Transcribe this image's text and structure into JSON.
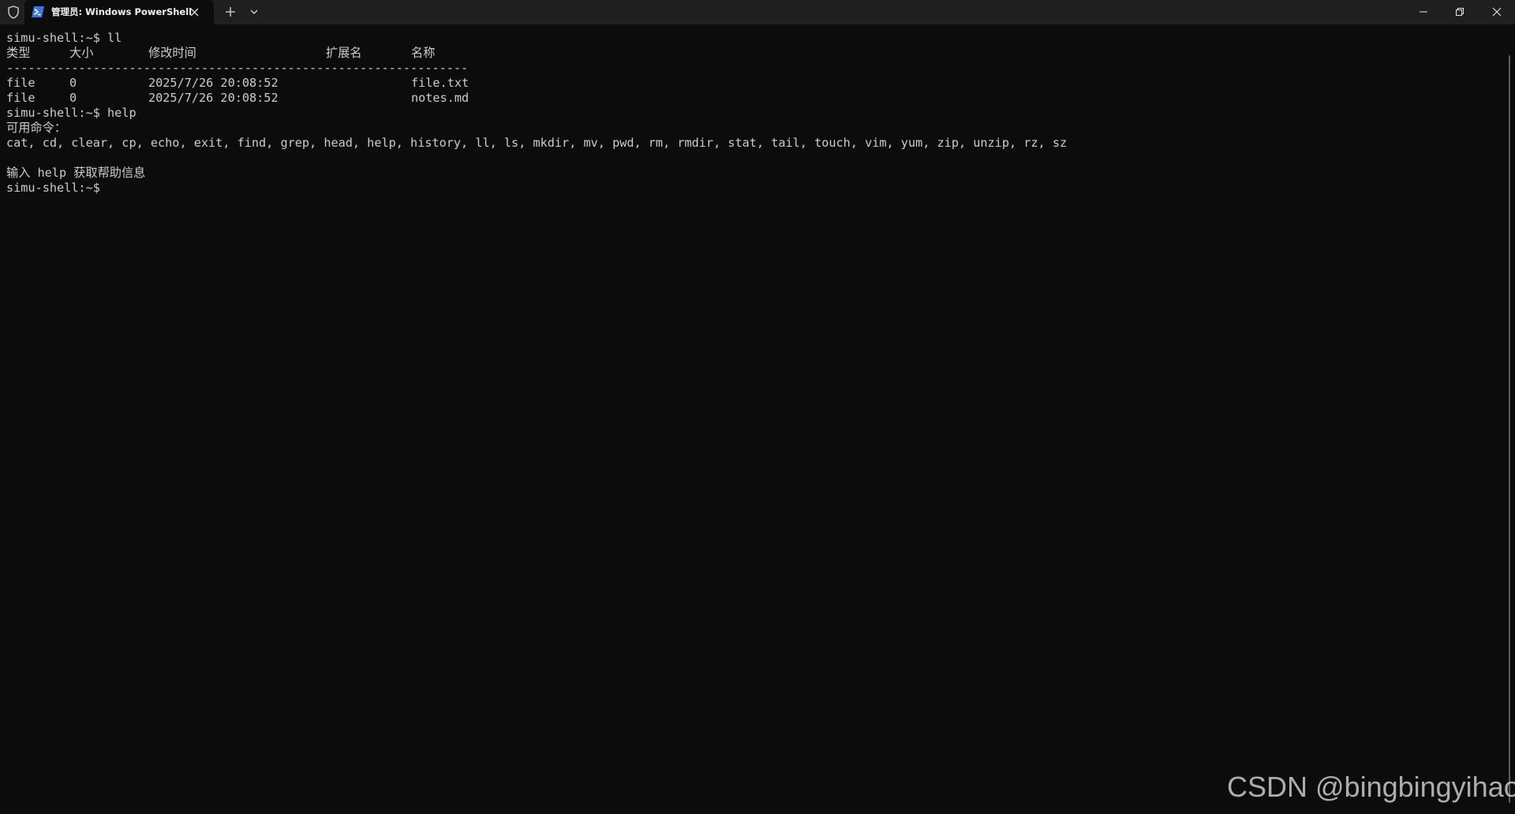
{
  "titlebar": {
    "tab_title": "管理员: Windows PowerShell",
    "icons": {
      "shield": "shield-icon",
      "tab": "powershell-icon",
      "tab_close": "close-icon",
      "new_tab": "plus-icon",
      "dropdown": "chevron-down-icon",
      "minimize": "minimize-icon",
      "restore": "restore-icon",
      "close": "close-icon"
    }
  },
  "terminal": {
    "prompt": "simu-shell:~$",
    "commands": [
      "ll",
      "help"
    ],
    "table_headers": [
      "类型",
      "大小",
      "修改时间",
      "扩展名",
      "名称"
    ],
    "separator": "----------------------------------------------------------------",
    "rows": [
      {
        "type": "file",
        "size": "0",
        "modified": "2025/7/26 20:08:52",
        "ext": "",
        "name": "file.txt"
      },
      {
        "type": "file",
        "size": "0",
        "modified": "2025/7/26 20:08:52",
        "ext": "",
        "name": "notes.md"
      }
    ],
    "available_label": "可用命令：",
    "command_list": "cat, cd, clear, cp, echo, exit, find, grep, head, help, history, ll, ls, mkdir, mv, pwd, rm, rmdir, stat, tail, touch, vim, yum, zip, unzip, rz, sz",
    "hint": "输入 help 获取帮助信息"
  },
  "watermark": "CSDN @bingbingyihao",
  "colors": {
    "background": "#0c0c0c",
    "titlebar": "#1f1f1f",
    "text": "#cccccc",
    "tab_icon": "#3b78d8"
  }
}
